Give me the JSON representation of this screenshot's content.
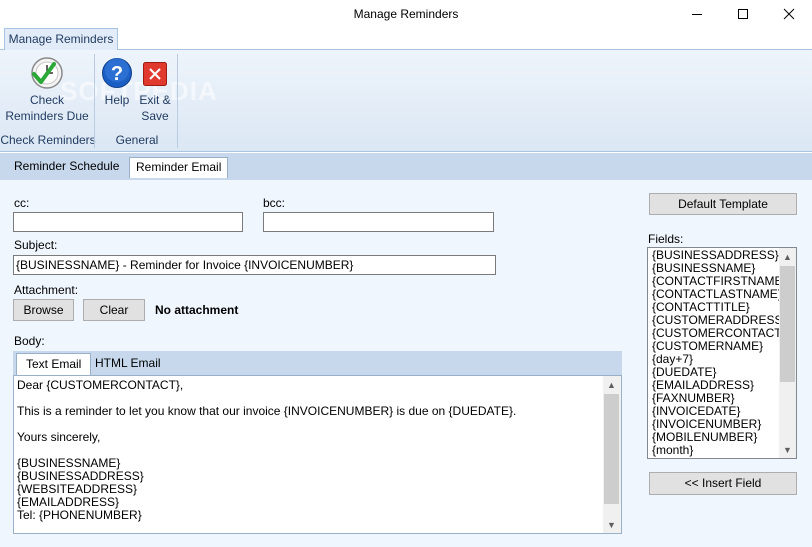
{
  "window": {
    "title": "Manage Reminders",
    "minimize_icon": "minimize-icon",
    "maximize_icon": "maximize-icon",
    "close_icon": "close-icon"
  },
  "ribbon": {
    "tab": "Manage Reminders",
    "watermark": "SOFTPEDIA",
    "groups": [
      {
        "label": "Check Reminders",
        "buttons": [
          {
            "line1": "Check",
            "line2": "Reminders Due",
            "icon": "clock-check-icon"
          }
        ]
      },
      {
        "label": "General",
        "buttons": [
          {
            "line1": "Help",
            "line2": "",
            "icon": "help-icon"
          },
          {
            "line1": "Exit &",
            "line2": "Save",
            "icon": "exit-icon"
          }
        ]
      }
    ]
  },
  "tabs": [
    "Reminder Schedule",
    "Reminder Email"
  ],
  "active_tab": "Reminder Email",
  "form": {
    "cc_label": "cc:",
    "cc_value": "",
    "bcc_label": "bcc:",
    "bcc_value": "",
    "subject_label": "Subject:",
    "subject_value": "{BUSINESSNAME} - Reminder for Invoice {INVOICENUMBER}",
    "attachment_label": "Attachment:",
    "browse_label": "Browse",
    "clear_label": "Clear",
    "attachment_status": "No attachment",
    "body_label": "Body:",
    "body_tabs": [
      "Text Email",
      "HTML Email"
    ],
    "active_body_tab": "Text Email",
    "body_lines": [
      "Dear {CUSTOMERCONTACT},",
      "",
      "This is a reminder to let you know that our invoice {INVOICENUMBER} is due on {DUEDATE}.",
      "",
      "Yours sincerely,",
      "",
      "{BUSINESSNAME}",
      "{BUSINESSADDRESS}",
      "{WEBSITEADDRESS}",
      "{EMAILADDRESS}",
      "Tel: {PHONENUMBER}"
    ]
  },
  "right_panel": {
    "default_template_label": "Default Template",
    "fields_label": "Fields:",
    "fields": [
      "{BUSINESSADDRESS}",
      "{BUSINESSNAME}",
      "{CONTACTFIRSTNAME}",
      "{CONTACTLASTNAME}",
      "{CONTACTTITLE}",
      "{CUSTOMERADDRESS}",
      "{CUSTOMERCONTACT}",
      "{CUSTOMERNAME}",
      "{day+7}",
      "{DUEDATE}",
      "{EMAILADDRESS}",
      "{FAXNUMBER}",
      "{INVOICEDATE}",
      "{INVOICENUMBER}",
      "{MOBILENUMBER}",
      "{month}"
    ],
    "insert_field_label": "<< Insert Field"
  },
  "colors": {
    "ribbon_bg": "#dbe7f4",
    "tabstrip_bg": "#c7d8ec",
    "content_bg": "#f0f6fd",
    "accent": "#1f3a5f"
  }
}
